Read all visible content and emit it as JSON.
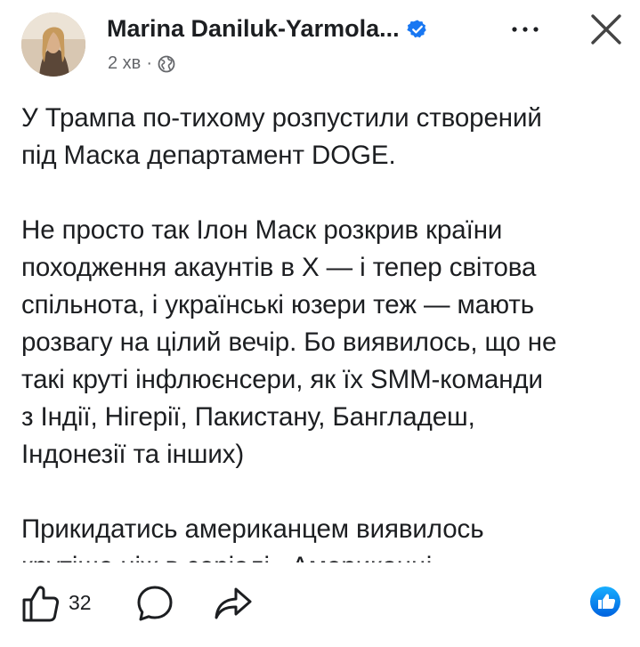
{
  "post": {
    "author": "Marina Daniluk-Yarmola...",
    "time": "2 хв",
    "separator": "·",
    "icons": {
      "verified": "verified-badge-icon",
      "audience": "globe-icon",
      "more": "more-horizontal-icon",
      "close": "close-icon"
    },
    "paragraphs": [
      [
        "У Трампа по-тихому розпустили створений",
        "під Маска департамент DOGE."
      ],
      [
        "Не просто так Ілон Маск розкрив країни",
        "походження акаунтів в Х — і тепер світова",
        "спільнота, і українські юзери теж — мають",
        "розвагу на цілий вечір. Бо виявилось, що не",
        "такі круті інфлюєнсери, як їх SMM-команди",
        "з Індії, Нігерії, Пакистану, Бангладеш,",
        "Індонезії та інших)"
      ],
      [
        "Прикидатись американцем виявилось",
        "крутіше ніж в серіалі «Американці»."
      ]
    ]
  },
  "actions": {
    "like_count": "32",
    "icons": {
      "like": "thumbs-up-icon",
      "comment": "comment-icon",
      "share": "share-icon",
      "reaction": "like-reaction-icon"
    }
  },
  "colors": {
    "accent": "#1877f2",
    "text": "#1c1e21",
    "secondary": "#65676b"
  }
}
